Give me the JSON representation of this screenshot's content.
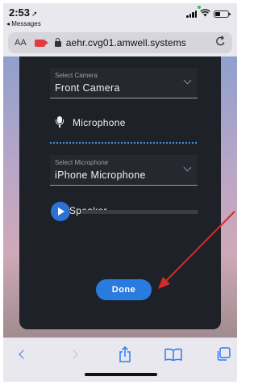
{
  "status_bar": {
    "time": "2:53",
    "location_icon": "location-arrow-icon",
    "back_app": "◂ Messages",
    "signal_icon": "signal-bars-icon",
    "wifi_icon": "wifi-icon",
    "battery_icon": "battery-icon",
    "battery_level": 0.4
  },
  "address_bar": {
    "text_size_label": "AA",
    "camera_indicator_icon": "video-camera-icon",
    "lock_icon": "lock-icon",
    "url": "aehr.cvg01.amwell.systems",
    "reload_icon": "reload-icon"
  },
  "modal": {
    "camera_select": {
      "label": "Select Camera",
      "value": "Front Camera"
    },
    "microphone": {
      "heading": "Microphone",
      "icon": "microphone-icon"
    },
    "microphone_select": {
      "label": "Select Microphone",
      "value": "iPhone Microphone"
    },
    "speaker": {
      "heading": "Speaker",
      "icon": "speaker-icon",
      "playback_progress": 0.0
    },
    "done_label": "Done"
  },
  "toolbar": {
    "back_icon": "chevron-left-icon",
    "forward_icon": "chevron-right-icon",
    "share_icon": "share-icon",
    "bookmarks_icon": "book-icon",
    "tabs_icon": "tabs-icon"
  },
  "colors": {
    "accent": "#2a7be0",
    "modal_bg": "#1e2127",
    "annotation_arrow": "#d42a2a",
    "safari_blue": "#2f7bf5"
  }
}
